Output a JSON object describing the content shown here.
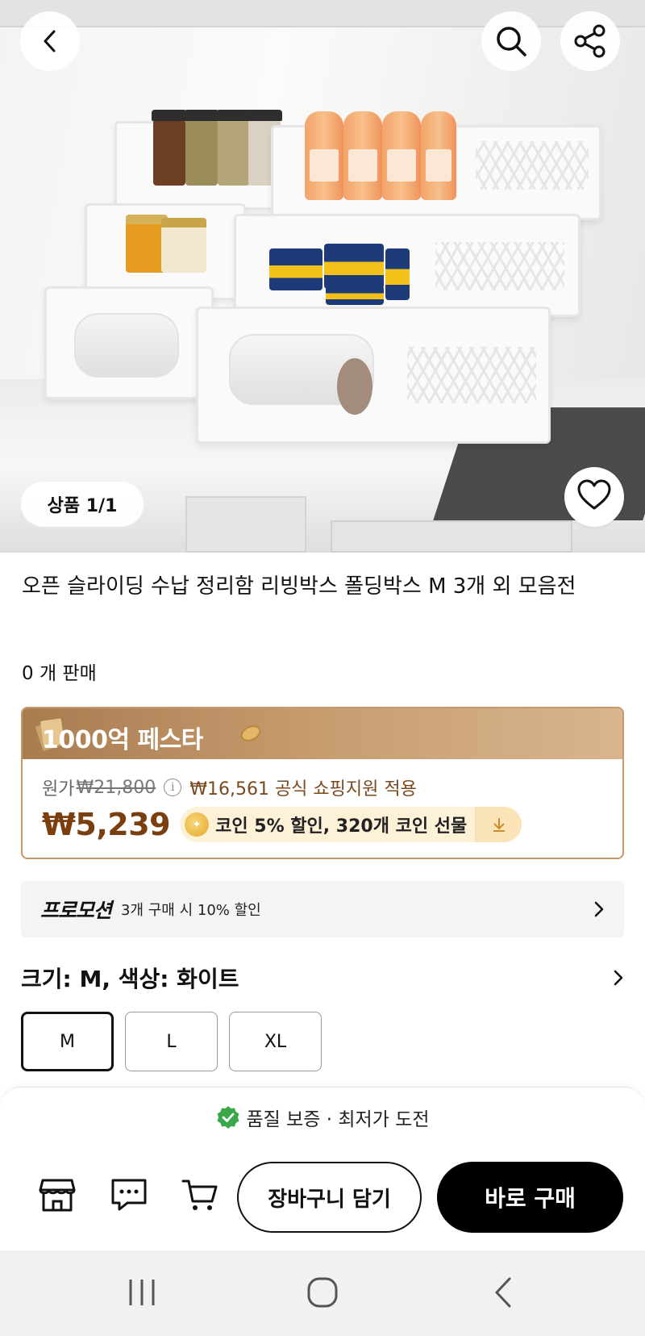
{
  "header": {
    "back_icon": "chevron-left-icon",
    "search_icon": "search-icon",
    "share_icon": "share-icon"
  },
  "gallery": {
    "counter": "상품 1/1",
    "wishlist_icon": "heart-icon"
  },
  "product": {
    "title": "오픈 슬라이딩 수납 정리함 리빙박스 폴딩박스 M 3개 외 모음전",
    "sold_count": "0 개 판매"
  },
  "price_card": {
    "banner": "1000억 페스타",
    "original_label": "원가",
    "original_price": "₩21,800",
    "support_text": "₩16,561 공식 쇼핑지원 적용",
    "sale_price": "₩5,239",
    "coin_text": "코인 5% 할인,  320개 코인 선물",
    "colors": {
      "sale": "#7a3e0f",
      "border": "#c49a6c"
    }
  },
  "promotion": {
    "label": "프로모션",
    "text": "3개 구매 시 10% 할인"
  },
  "options": {
    "label": "크기: M, 색상: 화이트",
    "sizes": [
      {
        "label": "M",
        "selected": true
      },
      {
        "label": "L",
        "selected": false
      },
      {
        "label": "XL",
        "selected": false
      }
    ]
  },
  "bottom_bar": {
    "guarantee": "품질 보증 · 최저가 도전",
    "store_icon": "store-icon",
    "chat_icon": "chat-icon",
    "cart_icon": "cart-icon",
    "add_to_cart": "장바구니 담기",
    "buy_now": "바로 구매"
  },
  "system_nav": {
    "recents_icon": "recent-apps-icon",
    "home_icon": "home-icon",
    "back_icon": "back-icon"
  }
}
